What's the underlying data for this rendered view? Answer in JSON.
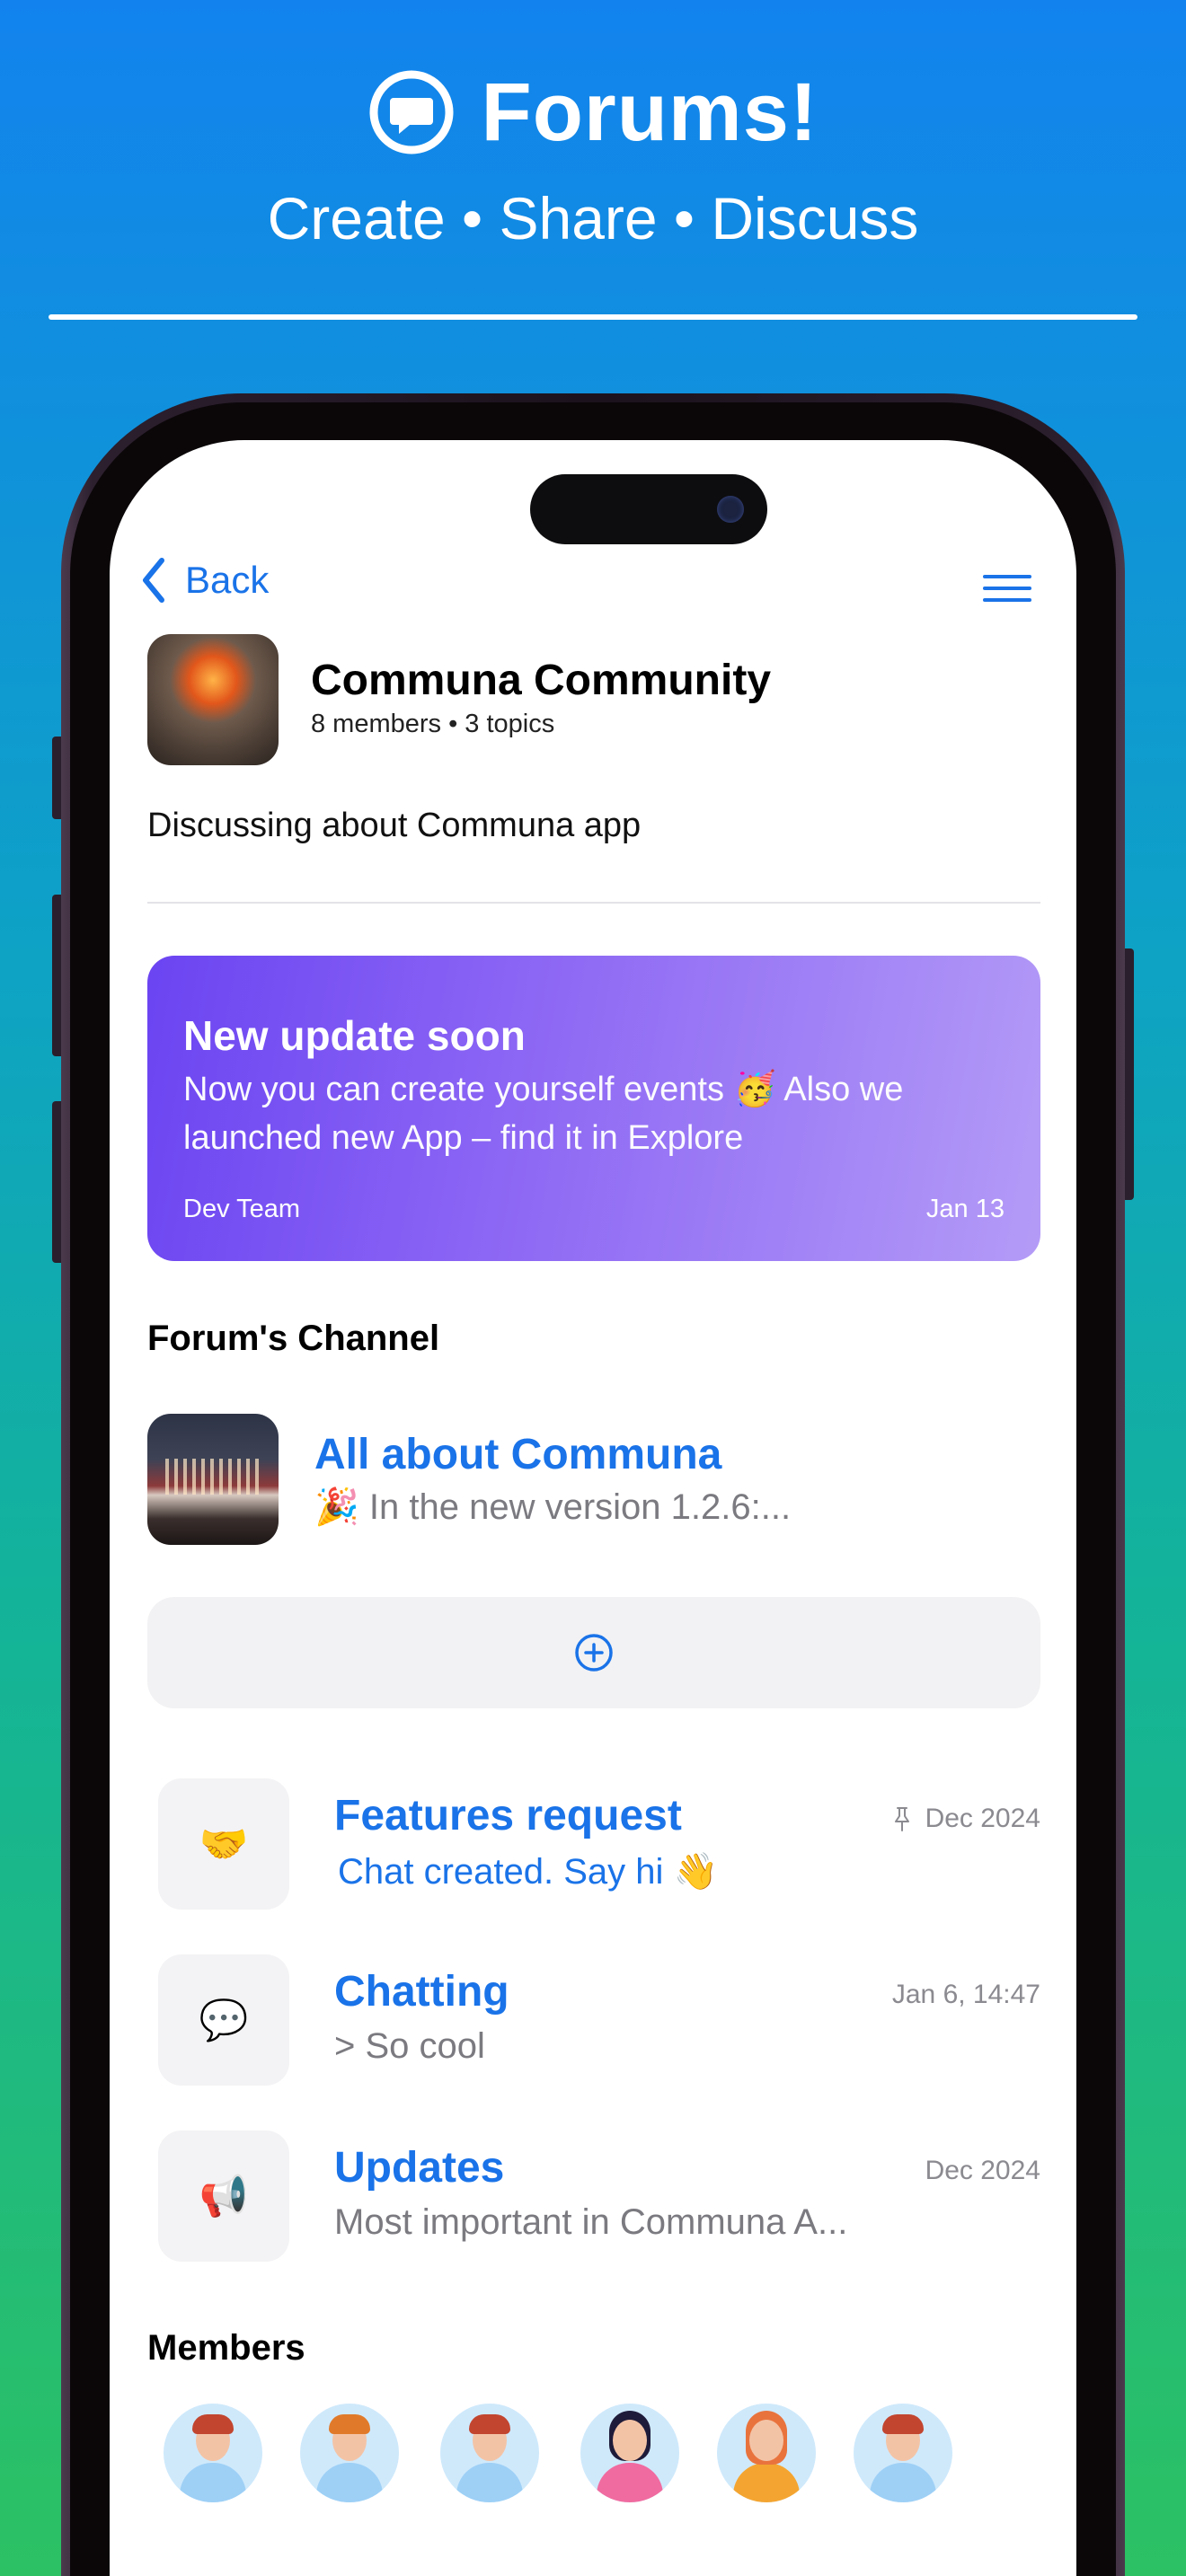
{
  "promo": {
    "title": "Forums!",
    "subtitle": "Create • Share • Discuss",
    "icon": "chat-bubble-icon"
  },
  "nav": {
    "back_label": "Back",
    "menu_icon": "hamburger-menu-icon"
  },
  "community": {
    "name": "Communa Community",
    "meta": "8 members • 3 topics",
    "description": "Discussing about Communa app"
  },
  "announcement": {
    "title": "New update soon",
    "body": "Now you can create yourself events 🥳 Also we launched new App – find it in Explore",
    "author": "Dev Team",
    "date": "Jan 13"
  },
  "channel_section": {
    "title": "Forum's Channel"
  },
  "channel": {
    "title": "All about Communa",
    "preview": "🎉 In the new version 1.2.6:..."
  },
  "topics": [
    {
      "icon": "🤝",
      "icon_name": "handshake-icon",
      "title": "Features request",
      "subtitle": "Chat created. Say hi 👋",
      "date": "Dec 2024",
      "pinned": true
    },
    {
      "icon": "💬",
      "icon_name": "speech-bubble-icon",
      "title": "Chatting",
      "subtitle": ">  So cool",
      "date": "Jan 6, 14:47",
      "pinned": false
    },
    {
      "icon": "📢",
      "icon_name": "megaphone-icon",
      "title": "Updates",
      "subtitle": "Most important in Communa A...",
      "date": "Dec 2024",
      "pinned": false
    }
  ],
  "members_section": {
    "title": "Members"
  },
  "colors": {
    "accent": "#1a73e8",
    "announcement_start": "#6b44f2",
    "announcement_end": "#b49bf7"
  }
}
